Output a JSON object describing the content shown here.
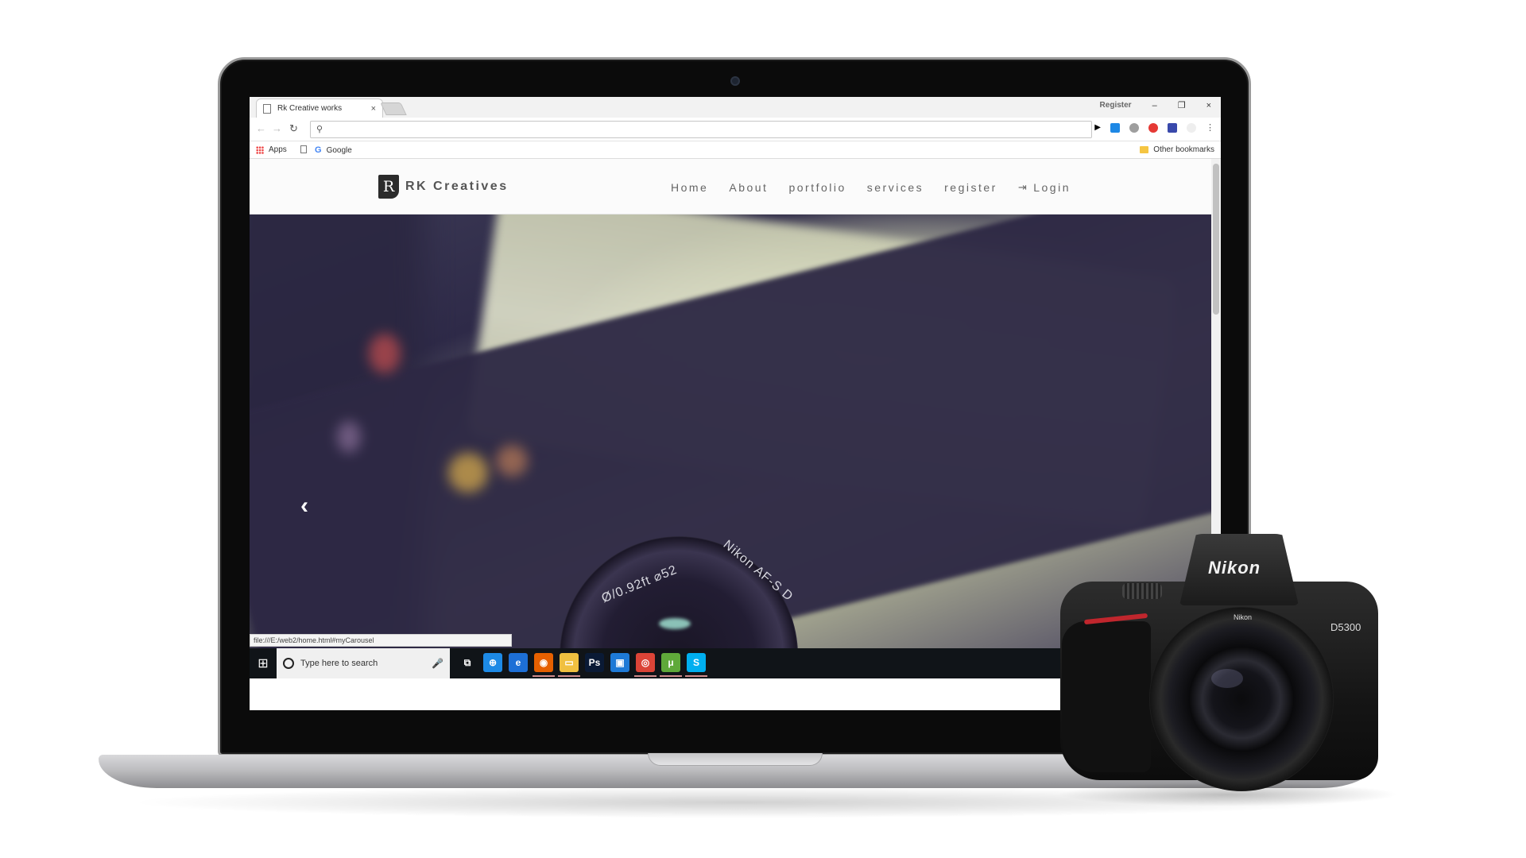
{
  "browser": {
    "tab_title": "Rk Creative works",
    "tab_close": "×",
    "profile_label": "Register",
    "minimize": "–",
    "restore": "❐",
    "close": "×",
    "back": "←",
    "forward": "→",
    "reload": "↻",
    "omnibox_placeholder": "",
    "search_glyph": "⚲",
    "menu": "⋮",
    "bookmarks": {
      "apps": "Apps",
      "google_letter": "G",
      "google": "Google",
      "other": "Other bookmarks"
    },
    "status_url": "file:///E:/web2/home.html#myCarousel"
  },
  "site": {
    "brand_logo": "R",
    "brand_name": "RK Creatives",
    "nav": [
      "Home",
      "About",
      "portfolio",
      "services",
      "register",
      "Login"
    ],
    "login_icon": "⇥",
    "carousel_prev": "‹",
    "hero_lens_text_1": "Ø/0.92ft ⌀52",
    "hero_lens_text_2": "Nikon AF-S D"
  },
  "taskbar": {
    "start_icon": "⊞",
    "search_placeholder": "Type here to search",
    "mic_icon": "🎤",
    "apps": [
      {
        "name": "task-view",
        "glyph": "⧉",
        "color": "#101418",
        "active": false
      },
      {
        "name": "store",
        "glyph": "⊕",
        "color": "#1d8ae6",
        "active": false
      },
      {
        "name": "edge",
        "glyph": "e",
        "color": "#1d6fd6",
        "active": false
      },
      {
        "name": "firefox",
        "glyph": "◉",
        "color": "#e66000",
        "active": true
      },
      {
        "name": "file-explorer",
        "glyph": "▭",
        "color": "#f0c040",
        "active": true
      },
      {
        "name": "photoshop",
        "glyph": "Ps",
        "color": "#0a1a35",
        "active": false
      },
      {
        "name": "app-blue",
        "glyph": "▣",
        "color": "#1e7ad6",
        "active": false
      },
      {
        "name": "chrome",
        "glyph": "◎",
        "color": "#db4437",
        "active": true
      },
      {
        "name": "utorrent",
        "glyph": "μ",
        "color": "#5fa93a",
        "active": true
      },
      {
        "name": "skype",
        "glyph": "S",
        "color": "#00aff0",
        "active": true
      }
    ]
  },
  "camera": {
    "brand": "Nikon",
    "model": "D5300",
    "lens_label": "Nikon"
  }
}
